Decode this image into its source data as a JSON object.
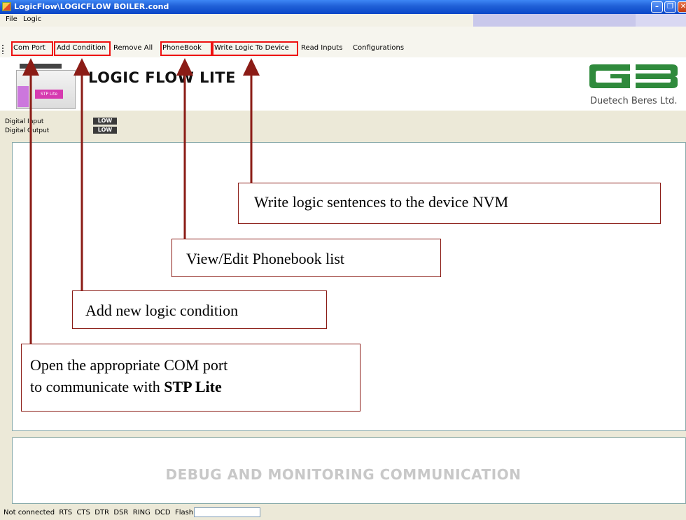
{
  "window": {
    "title": "LogicFlow\\LOGICFLOW BOILER.cond",
    "minimize": "–",
    "maximize": "❐",
    "close": "✕"
  },
  "menu": {
    "file": "File",
    "logic": "Logic"
  },
  "toolbar": {
    "com_port": "Com Port",
    "add_condition": "Add Condition",
    "remove_all": "Remove All",
    "phonebook": "PhoneBook",
    "write_logic": "Write Logic To Device",
    "read_inputs": "Read Inputs",
    "configurations": "Configurations"
  },
  "banner": {
    "app_title": "LOGIC FLOW LITE",
    "device_label": "STP Lite",
    "company": "Duetech Beres Ltd."
  },
  "io": {
    "digital_input_label": "Digital Input",
    "digital_input_value": "LOW",
    "digital_output_label": "Digital Output",
    "digital_output_value": "LOW"
  },
  "debug": {
    "title": "DEBUG AND MONITORING COMMUNICATION"
  },
  "status": {
    "text": "Not connected  RTS  CTS  DTR  DSR  RING  DCD  Flash",
    "flash_value": ""
  },
  "callouts": {
    "write": "Write logic sentences to the device NVM",
    "phonebook": "View/Edit Phonebook list",
    "add_condition": "Add new logic condition",
    "com_port_line1": "Open the appropriate COM port",
    "com_port_line2_prefix": "to communicate with ",
    "com_port_line2_bold": "STP Lite"
  },
  "colors": {
    "highlight": "#ee1111",
    "arrow": "#8b1c16",
    "logo_green": "#2f8a3c"
  }
}
